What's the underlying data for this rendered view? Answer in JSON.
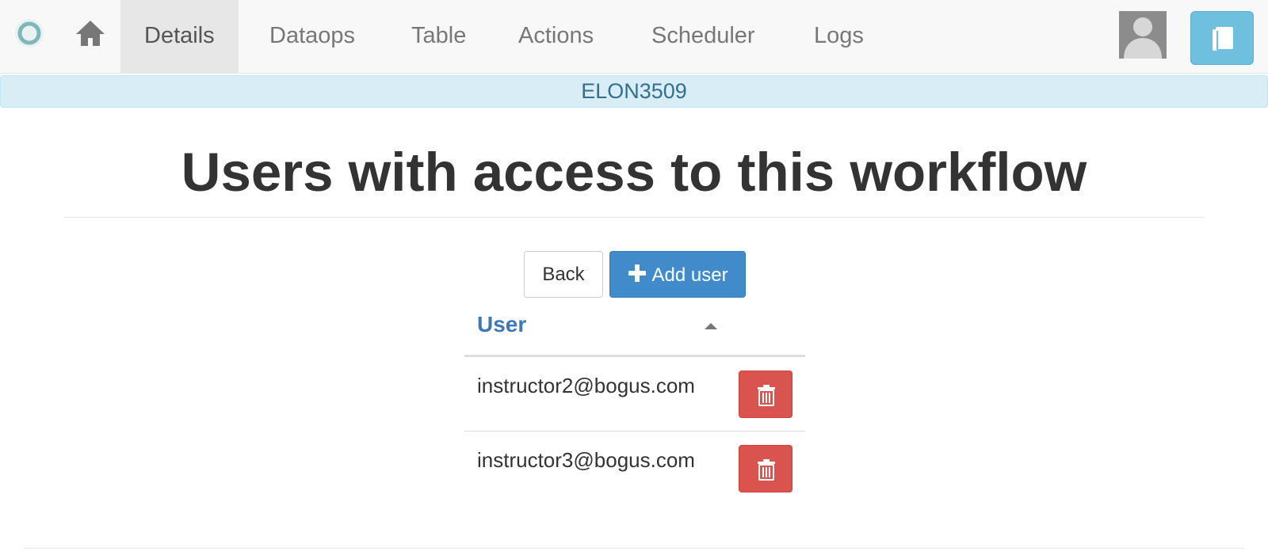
{
  "nav": {
    "tabs": [
      "Details",
      "Dataops",
      "Table",
      "Actions",
      "Scheduler",
      "Logs"
    ],
    "active_tab": "Details",
    "logo_icon": "logo-ring-icon",
    "home_icon": "home-icon",
    "avatar_icon": "user-avatar-icon",
    "book_icon": "book-icon"
  },
  "banner": {
    "text": "ELON3509"
  },
  "page": {
    "title": "Users with access to this workflow"
  },
  "toolbar": {
    "back_label": "Back",
    "add_user_label": "Add user",
    "add_icon": "plus-icon"
  },
  "table": {
    "columns": [
      "User"
    ],
    "sort": "ascending",
    "rows": [
      {
        "email": "instructor2@bogus.com",
        "action_icon": "trash-icon"
      },
      {
        "email": "instructor3@bogus.com",
        "action_icon": "trash-icon"
      }
    ]
  },
  "colors": {
    "primary": "#428bca",
    "danger": "#d9534f",
    "info_bg": "#d9edf7",
    "info_text": "#31708f",
    "header_link": "#3f78b5",
    "book_button": "#6fbfdf"
  }
}
